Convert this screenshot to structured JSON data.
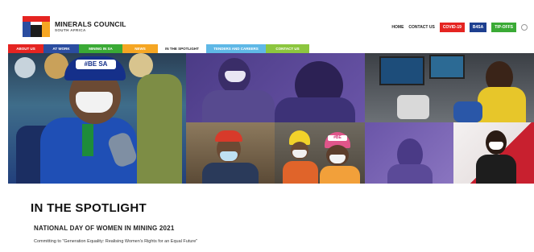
{
  "header": {
    "logo_title": "MINERALS COUNCIL",
    "logo_subtitle": "SOUTH AFRICA",
    "links": [
      "HOME",
      "CONTACT US"
    ],
    "buttons": [
      {
        "label": "COVID-19",
        "color": "#e52421"
      },
      {
        "label": "B4SA",
        "color": "#1d3f8f"
      },
      {
        "label": "TIP-OFFS",
        "color": "#3aaa35"
      }
    ],
    "search_icon": "search-icon"
  },
  "nav": [
    {
      "label": "ABOUT US",
      "color": "#e52421"
    },
    {
      "label": "AT WORK",
      "color": "#2b4da0"
    },
    {
      "label": "MINING IN SA",
      "color": "#3aaa35"
    },
    {
      "label": "NEWS",
      "color": "#f5a623"
    },
    {
      "label": "IN THE SPOTLIGHT",
      "color": "#ffffff"
    },
    {
      "label": "TENDERS AND CAREERS",
      "color": "#5fb8e6"
    },
    {
      "label": "CONTACT US",
      "color": "#8cc63f"
    }
  ],
  "content": {
    "title": "IN THE SPOTLIGHT",
    "subtitle": "NATIONAL DAY OF WOMEN IN MINING 2021",
    "text": "Committing to \"Generation Equality: Realising Women's Rights for an Equal Future\""
  },
  "hero": {
    "helmet_text": "#BE SA",
    "helmet_text_small": "#BE"
  }
}
